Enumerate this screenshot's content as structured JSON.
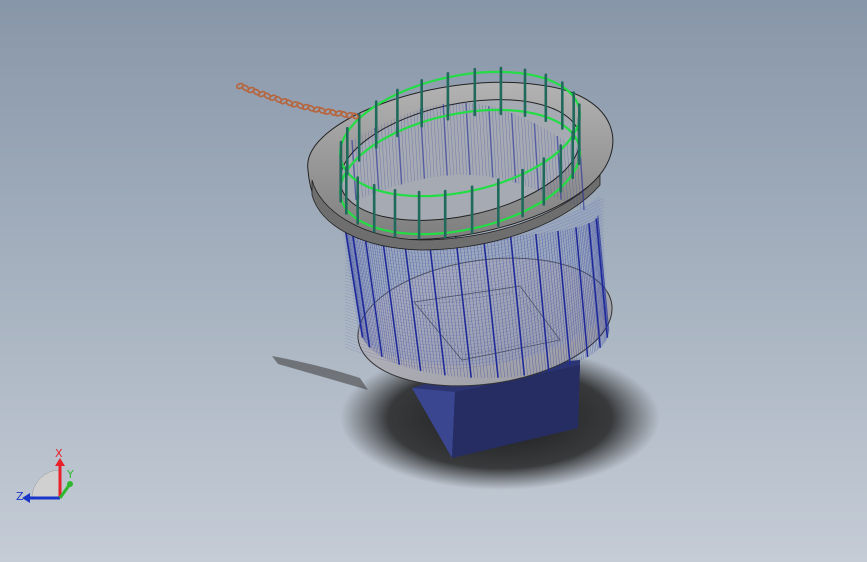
{
  "viewport": {
    "background_top": "#8896a9",
    "background_bottom": "#c5ccd6"
  },
  "model": {
    "flange_color": "#9a9a9a",
    "mesh_color": "#1f2a9a",
    "ring_color": "#22dd44",
    "post_color": "#1f6a5a",
    "base_block_color": "#2c3572",
    "chain_color": "#b8643a",
    "shadow_color": "#1e1e1e"
  },
  "triad": {
    "x_label": "X",
    "y_label": "Y",
    "z_label": "Z",
    "x_color": "#e8202a",
    "y_color": "#2eb82e",
    "z_color": "#1a36c8",
    "icons": [
      "axis-x-arrow-icon",
      "axis-y-arrow-icon",
      "axis-z-arrow-icon"
    ]
  }
}
